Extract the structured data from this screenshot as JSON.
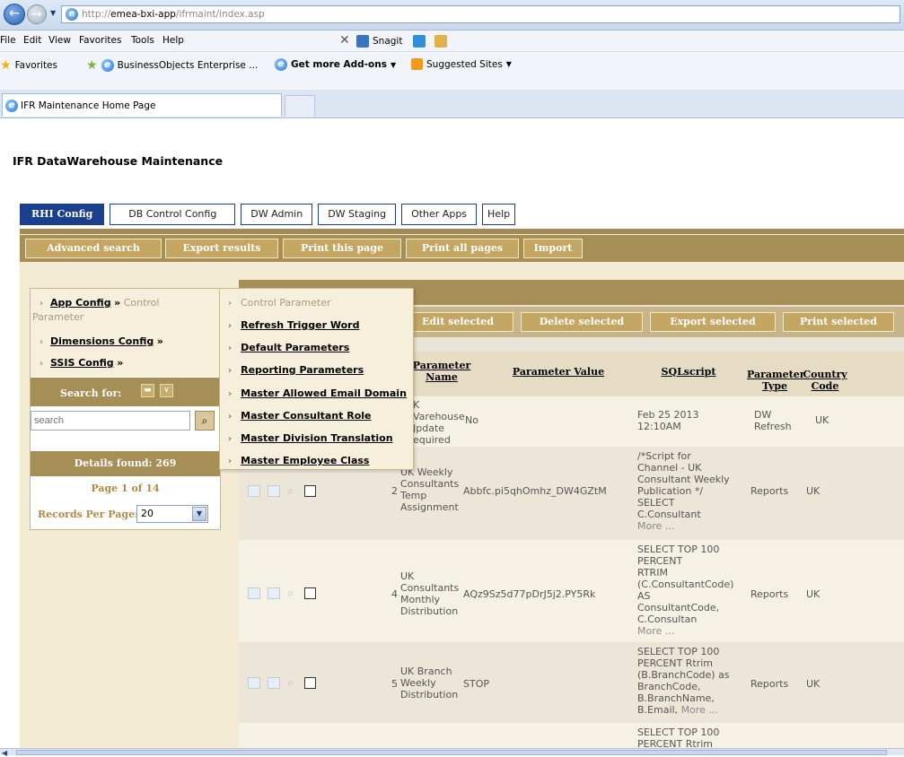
{
  "browser": {
    "url_prefix": "http://",
    "url_host": "emea-bxi-app",
    "url_path": "/ifrmaint/index.asp",
    "menu": [
      "File",
      "Edit",
      "View",
      "Favorites",
      "Tools",
      "Help"
    ],
    "toolbar_snagit": "Snagit",
    "favorites_label": "Favorites",
    "favorites": [
      "BusinessObjects Enterprise ...",
      "Get more Add-ons",
      "Suggested Sites"
    ],
    "tab_title": "IFR Maintenance Home Page"
  },
  "page": {
    "title": "IFR DataWarehouse Maintenance",
    "tabs": [
      "RHI Config",
      "DB Control Config",
      "DW Admin",
      "DW Staging",
      "Other Apps",
      "Help"
    ],
    "top_buttons": [
      "Advanced search",
      "Export results",
      "Print this page",
      "Print all pages",
      "Import"
    ]
  },
  "left": {
    "app_config": "App Config",
    "breadcrumb_sep": "»",
    "control_param": "Control",
    "control_param2": "Parameter",
    "dimensions_config": "Dimensions Config",
    "ssis_config": "SSIS Config",
    "search_for": "Search for:",
    "search_placeholder": "search",
    "details_found": "Details found: 269",
    "page_info": "Page 1 of 14",
    "records_per_page": "Records Per Page:",
    "records_per_page_value": "20"
  },
  "dropdown": {
    "items": [
      "Control Parameter",
      "Refresh Trigger Word",
      "Default Parameters",
      "Reporting Parameters",
      "Master Allowed Email Domain",
      "Master Consultant Role",
      "Master Division Translation",
      "Master Employee Class"
    ]
  },
  "actions": [
    "Edit selected",
    "Delete selected",
    "Export selected",
    "Print selected"
  ],
  "table": {
    "headers": {
      "param_name_1": "Parameter",
      "param_name_2": "Name",
      "param_value": "Parameter Value",
      "sqlscript": "SQLscript",
      "param_type_1": "Parameter",
      "param_type_2": "Type",
      "country_1": "Country",
      "country_2": "Code"
    },
    "rows": [
      {
        "num": "",
        "name": [
          "K",
          "Varehouse",
          "Jpdate",
          "equired"
        ],
        "value": "No",
        "sql": [
          "Feb 25 2013",
          "12:10AM"
        ],
        "more": "",
        "type": [
          "DW",
          "Refresh"
        ],
        "country": "UK"
      },
      {
        "num": "2",
        "name": [
          "UK Weekly",
          "Consultants",
          "Temp",
          "Assignment"
        ],
        "value": "Abbfc.pi5qhOmhz_DW4GZtM",
        "sql": [
          "/*Script for",
          "Channel - UK",
          "Consultant Weekly",
          "Publication */",
          "SELECT",
          "C.Consultant"
        ],
        "more": "More ...",
        "type": [
          "Reports"
        ],
        "country": "UK"
      },
      {
        "num": "4",
        "name": [
          "UK",
          "Consultants",
          "Monthly",
          "Distribution"
        ],
        "value": "AQz9Sz5d77pDrJ5j2.PY5Rk",
        "sql": [
          "SELECT TOP 100",
          "PERCENT",
          "RTRIM",
          "(C.ConsultantCode)",
          "AS",
          "ConsultantCode,",
          "C.Consultan"
        ],
        "more": "More ...",
        "type": [
          "Reports"
        ],
        "country": "UK"
      },
      {
        "num": "5",
        "name": [
          "UK Branch",
          "Weekly",
          "Distribution"
        ],
        "value": "STOP",
        "sql": [
          "SELECT TOP 100",
          "PERCENT Rtrim",
          "(B.BranchCode) as",
          "BranchCode,",
          "B.BranchName,",
          "B.Email,"
        ],
        "more": "More ...",
        "type": [
          "Reports"
        ],
        "country": "UK"
      },
      {
        "num": "",
        "name": [],
        "value": "",
        "sql": [
          "SELECT TOP 100",
          "PERCENT Rtrim"
        ],
        "more": "",
        "type": [],
        "country": ""
      }
    ]
  }
}
